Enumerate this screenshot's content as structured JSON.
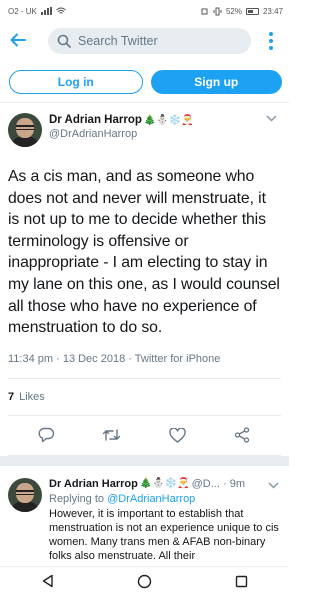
{
  "status_bar": {
    "carrier": "O2 - UK",
    "battery": "52%",
    "time": "23:47"
  },
  "header": {
    "search_placeholder": "Search Twitter"
  },
  "auth": {
    "login_label": "Log in",
    "signup_label": "Sign up"
  },
  "tweet": {
    "name": "Dr Adrian Harrop",
    "name_emoji": "🎄⛄❄️🎅",
    "handle": "@DrAdrianHarrop",
    "text": "As a cis man, and as someone who does not and never will menstruate, it is not up to me to decide whether this terminology is offensive or inappropriate - I am electing to stay in my lane on this one, as I would counsel all those who have no experience of menstruation to do so.",
    "meta": "11:34 pm · 13 Dec 2018 · Twitter for iPhone",
    "likes_count": "7",
    "likes_label": "Likes"
  },
  "reply": {
    "name": "Dr Adrian Harrop",
    "name_emoji": "🎄⛄❄️🎅",
    "meta": "@D... · 9m",
    "replying_prefix": "Replying to",
    "replying_handle": "@DrAdrianHarrop",
    "text": "However, it is important to establish that menstruation is not an experience unique to cis women. Many trans men & AFAB non-binary folks also menstruate. All their"
  },
  "colors": {
    "accent": "#1da1f2",
    "muted": "#657786",
    "divider": "#e6ecf0"
  }
}
